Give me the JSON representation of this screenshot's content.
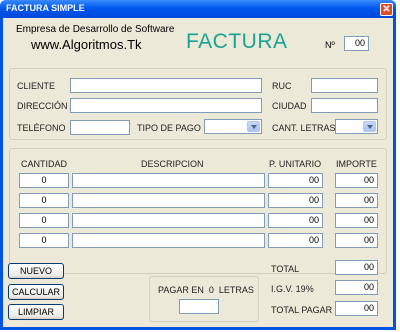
{
  "window": {
    "title": "FACTURA SIMPLE"
  },
  "header": {
    "company": "Empresa de Desarrollo de Software",
    "website": "www.Algoritmos.Tk",
    "title": "FACTURA",
    "number_label": "Nº",
    "number_value": "00"
  },
  "client": {
    "cliente_label": "CLIENTE",
    "direccion_label": "DIRECCIÓN",
    "telefono_label": "TELÉFONO",
    "ruc_label": "RUC",
    "ciudad_label": "CIUDAD",
    "tipo_pago_label": "TIPO DE PAGO",
    "cant_letras_label": "CANT. LETRAS"
  },
  "items": {
    "headers": {
      "cantidad": "CANTIDAD",
      "descripcion": "DESCRIPCION",
      "unitario": "P. UNITARIO",
      "importe": "IMPORTE"
    },
    "rows": [
      {
        "cantidad": "0",
        "descripcion": "",
        "unitario": "00",
        "importe": "00"
      },
      {
        "cantidad": "0",
        "descripcion": "",
        "unitario": "00",
        "importe": "00"
      },
      {
        "cantidad": "0",
        "descripcion": "",
        "unitario": "00",
        "importe": "00"
      },
      {
        "cantidad": "0",
        "descripcion": "",
        "unitario": "00",
        "importe": "00"
      }
    ]
  },
  "buttons": {
    "nuevo": "NUEVO",
    "calcular": "CALCULAR",
    "limpiar": "LIMPIAR"
  },
  "pagar": {
    "label": "PAGAR EN  0  LETRAS"
  },
  "totals": {
    "total_label": "TOTAL",
    "total_value": "00",
    "igv_label": "I.G.V. 19%",
    "igv_value": "00",
    "total_pagar_label": "TOTAL PAGAR",
    "total_pagar_value": "00"
  }
}
